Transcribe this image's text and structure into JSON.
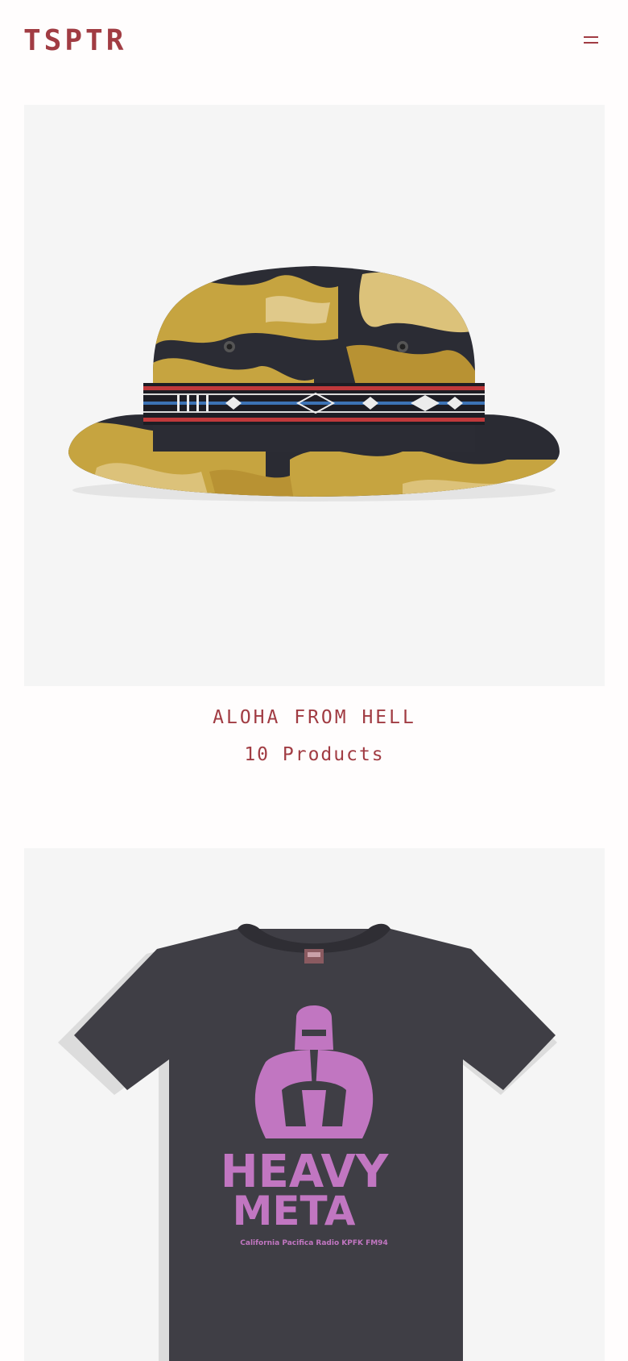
{
  "brand": {
    "logo_text": "TSPTR",
    "accent_color": "#a13c43"
  },
  "header": {
    "menu_icon": "hamburger-icon"
  },
  "collections": [
    {
      "title": "ALOHA FROM HELL",
      "count_label": "10 Products",
      "image": "camo-bucket-hat"
    },
    {
      "title": "",
      "count_label": "",
      "image": "heavy-meta-tshirt",
      "print_text_top": "HEAVY",
      "print_text_bottom": "META",
      "print_caption": "California Pacifica Radio KPFK FM94"
    }
  ]
}
